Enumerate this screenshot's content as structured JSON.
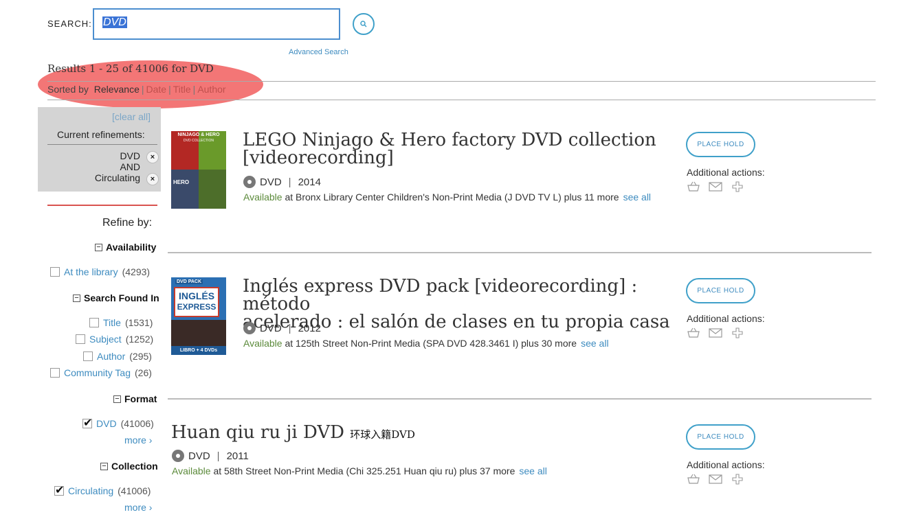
{
  "search": {
    "label": "SEARCH:",
    "query": "DVD",
    "advanced_link": "Advanced Search"
  },
  "results": {
    "summary": "Results 1 - 25 of 41006 for DVD",
    "sorted_by_label": "Sorted by",
    "sort_options": [
      "Relevance",
      "Date",
      "Title",
      "Author"
    ],
    "sort_separator": "|"
  },
  "refinements": {
    "clear_all": "[clear all]",
    "current_label": "Current refinements:",
    "items": [
      "DVD",
      "AND",
      "Circulating"
    ],
    "close_glyph": "×"
  },
  "refine_by": "Refine by:",
  "facets": {
    "availability": {
      "heading": "Availability",
      "items": [
        {
          "label": "At the library",
          "count": "(4293)"
        }
      ]
    },
    "search_found_in": {
      "heading": "Search Found In",
      "items": [
        {
          "label": "Title",
          "count": "(1531)"
        },
        {
          "label": "Subject",
          "count": "(1252)"
        },
        {
          "label": "Author",
          "count": "(295)"
        },
        {
          "label": "Community Tag",
          "count": "(26)"
        }
      ]
    },
    "format": {
      "heading": "Format",
      "items": [
        {
          "label": "DVD",
          "count": "(41006)",
          "checked": true
        }
      ],
      "more": "more ›"
    },
    "collection": {
      "heading": "Collection",
      "items": [
        {
          "label": "Circulating",
          "count": "(41006)",
          "checked": true
        }
      ],
      "more": "more ›"
    }
  },
  "items": [
    {
      "title": "LEGO Ninjago & Hero factory DVD collection [videorecording]",
      "title_line1": "LEGO Ninjago & Hero factory DVD collection",
      "title_line2": "[videorecording]",
      "format": "DVD",
      "year": "2014",
      "available_word": "Available",
      "availability": "at Bronx Library Center Children's Non-Print Media (J DVD TV L) plus 11 more",
      "see_all": "see all",
      "hold": "PLACE HOLD",
      "additional": "Additional actions:",
      "cover_text": [
        "NINJAGO & HERO",
        "DVD COLLECTION",
        "HERO"
      ]
    },
    {
      "title": "Inglés express DVD pack [videorecording] : método acelerado : el salón de clases en tu propia casa",
      "title_line1": "Inglés express DVD pack [videorecording] : método",
      "title_line2": "acelerado : el salón de clases en tu propia casa",
      "format": "DVD",
      "year": "2012",
      "available_word": "Available",
      "availability": "at 125th Street Non-Print Media (SPA DVD 428.3461 I) plus 30 more",
      "see_all": "see all",
      "hold": "PLACE HOLD",
      "additional": "Additional actions:",
      "cover_text": [
        "DVD PACK",
        "INGLÉS",
        "EXPRESS",
        "LIBRO + 4 DVDs"
      ]
    },
    {
      "title": "Huan qiu ru ji DVD",
      "title_sub": "环球入籍DVD",
      "format": "DVD",
      "year": "2011",
      "available_word": "Available",
      "availability": "at 58th Street Non-Print Media (Chi 325.251 Huan qiu ru) plus 37 more",
      "see_all": "see all",
      "hold": "PLACE HOLD",
      "additional": "Additional actions:"
    }
  ],
  "icons": [
    "basket-icon",
    "mail-icon",
    "plus-icon",
    "search-icon",
    "disc-icon",
    "close-icon",
    "minus-icon"
  ],
  "colors": {
    "link": "#3d8bbf",
    "available": "#5b8a3a",
    "sort_option": "#c0504d",
    "highlight": "#f05050",
    "button_border": "#3fa0c9"
  }
}
